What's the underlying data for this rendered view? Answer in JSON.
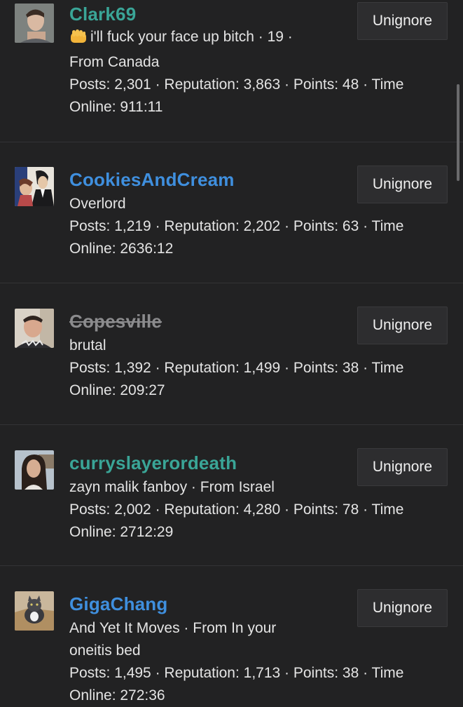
{
  "button_label": "Unignore",
  "users": [
    {
      "name": "Clark69",
      "name_color": "#3aa597",
      "strikethrough": false,
      "avatar_icon": "avatar-young-man-icon",
      "title_emoji": "fist-emoji-icon",
      "title_line": "i'll fuck your face up bitch · 19 ·",
      "title_line2": "From Canada",
      "stats": "Posts: 2,301 · Reputation: 3,863 · Points: 48 · Time Online: 911:11"
    },
    {
      "name": "CookiesAndCream",
      "name_color": "#3f8fde",
      "strikethrough": false,
      "avatar_icon": "avatar-comic-man-icon",
      "title_line": "Overlord",
      "stats": "Posts: 1,219 · Reputation: 2,202 · Points: 63 · Time Online: 2636:12"
    },
    {
      "name": "Copesville",
      "name_color": "#8b8b8d",
      "strikethrough": true,
      "avatar_icon": "avatar-man-selfie-icon",
      "title_line": "brutal",
      "stats": "Posts: 1,392 · Reputation: 1,499 · Points: 38 · Time Online: 209:27"
    },
    {
      "name": "curryslayerordeath",
      "name_color": "#3aa597",
      "strikethrough": false,
      "avatar_icon": "avatar-woman-icon",
      "title_line": "zayn malik fanboy · From Israel",
      "stats": "Posts: 2,002 · Reputation: 4,280 · Points: 78 · Time Online: 2712:29"
    },
    {
      "name": "GigaChang",
      "name_color": "#3f8fde",
      "strikethrough": false,
      "avatar_icon": "avatar-cat-in-box-icon",
      "title_line": "And Yet It Moves · From In your",
      "title_line2": "oneitis bed",
      "stats": "Posts: 1,495 · Reputation: 1,713 · Points: 38 · Time Online: 272:36"
    }
  ]
}
